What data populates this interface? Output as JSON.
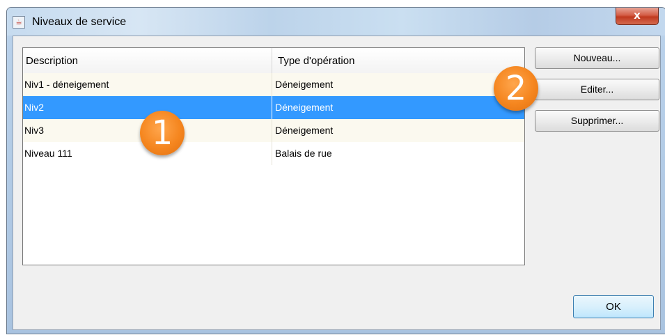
{
  "window": {
    "title": "Niveaux de service",
    "close_label": "x"
  },
  "table": {
    "columns": [
      "Description",
      "Type d'opération"
    ],
    "rows": [
      {
        "description": "Niv1 - déneigement",
        "type": "Déneigement"
      },
      {
        "description": "Niv2",
        "type": "Déneigement",
        "selected": true
      },
      {
        "description": "Niv3",
        "type": "Déneigement"
      },
      {
        "description": "Niveau 111",
        "type": "Balais de rue"
      }
    ]
  },
  "buttons": {
    "new_label": "Nouveau...",
    "edit_label": "Editer...",
    "delete_label": "Supprimer...",
    "ok_label": "OK"
  },
  "annotations": {
    "marker1": "1",
    "marker2": "2"
  },
  "colors": {
    "selection": "#3399ff",
    "marker": "#f5861f",
    "close_button": "#c0391f"
  }
}
